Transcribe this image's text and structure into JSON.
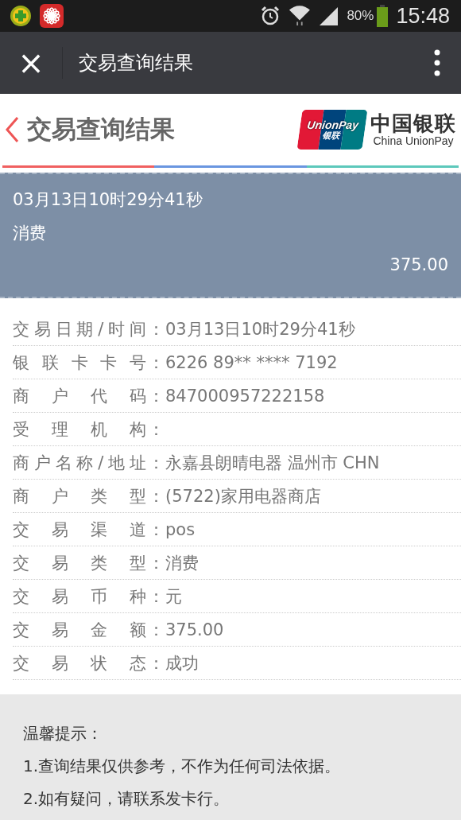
{
  "status_bar": {
    "battery_text": "80%",
    "time": "15:48"
  },
  "nav_bar": {
    "close": "×",
    "title": "交易查询结果"
  },
  "header": {
    "title": "交易查询结果",
    "logo_card_top": "UnionPay",
    "logo_card_bottom": "银联",
    "logo_cn": "中国银联",
    "logo_en": "China UnionPay"
  },
  "summary": {
    "datetime": "03月13日10时29分41秒",
    "type": "消费",
    "amount": "375.00"
  },
  "details": [
    {
      "label": "交易日期/时间",
      "separator": "：",
      "value": "03月13日10时29分41秒"
    },
    {
      "label": "银联卡卡号",
      "separator": "：",
      "value": "6226 89** **** 7192"
    },
    {
      "label": "商户代码",
      "separator": "：",
      "value": "847000957222158"
    },
    {
      "label": "受理机构",
      "separator": "："
    },
    {
      "label": "商户名称/地址",
      "separator": "：",
      "value": "永嘉县朗晴电器 温州市 CHN"
    },
    {
      "label": "商户类型",
      "separator": "：",
      "value": "(5722)家用电器商店"
    },
    {
      "label": "交易渠道",
      "separator": "：",
      "value": "pos"
    },
    {
      "label": "交易类型",
      "separator": "：",
      "value": "消费"
    },
    {
      "label": "交易币种",
      "separator": "：",
      "value": "元"
    },
    {
      "label": "交易金额",
      "separator": "：",
      "value": "375.00"
    },
    {
      "label": "交易状态",
      "separator": "：",
      "value": "成功"
    }
  ],
  "tips": {
    "title": "温馨提示：",
    "lines": [
      "1.查询结果仅供参考，不作为任何司法依据。",
      "2.如有疑问，请联系发卡行。"
    ]
  }
}
